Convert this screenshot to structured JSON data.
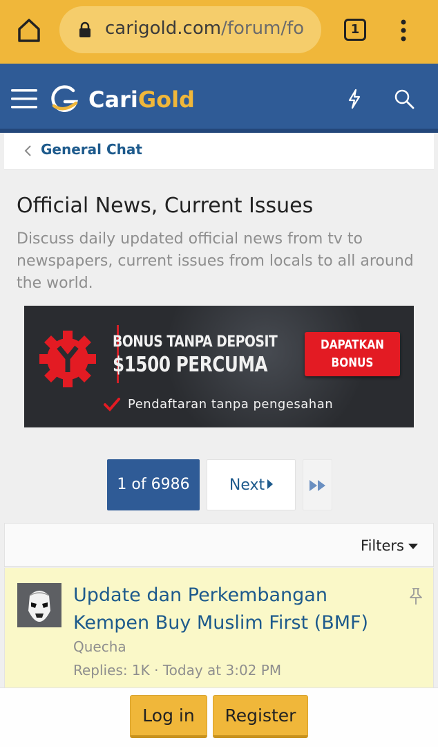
{
  "browser": {
    "url_domain": "carigold.com",
    "url_path": "/forum/fo",
    "tab_count": "1",
    "icons": [
      "home-icon",
      "lock-icon",
      "tab-switcher-icon",
      "overflow-menu-icon"
    ]
  },
  "header": {
    "logo_part1": "Cari",
    "logo_part2": "Gold",
    "icons": [
      "hamburger-menu-icon",
      "lightning-bolt-icon",
      "search-icon"
    ],
    "colors": {
      "header_bg": "#2f5b96",
      "gold": "#f0b73a"
    }
  },
  "breadcrumb": {
    "label": "General Chat"
  },
  "forum": {
    "title": "Official News, Current Issues",
    "description": "Discuss daily updated official news from tv to newspapers, current issues from locals to all around the world."
  },
  "ad": {
    "line1": "BONUS TANPA DEPOSIT",
    "line2": "$1500 PERCUMA",
    "cta_line1": "DAPATKAN",
    "cta_line2": "BONUS",
    "line3": "Pendaftaran tanpa pengesahan",
    "colors": {
      "accent": "#e31b23"
    }
  },
  "pagination": {
    "current": "1 of 6986",
    "next": "Next"
  },
  "filters": {
    "label": "Filters"
  },
  "thread": {
    "title": "Update dan Perkembangan Kempen Buy Muslim First (BMF)",
    "author": "Quecha",
    "meta": "Replies: 1K · Today at 3:02 PM",
    "pinned": true,
    "background": "#faf8c8"
  },
  "footer": {
    "login": "Log in",
    "register": "Register"
  }
}
